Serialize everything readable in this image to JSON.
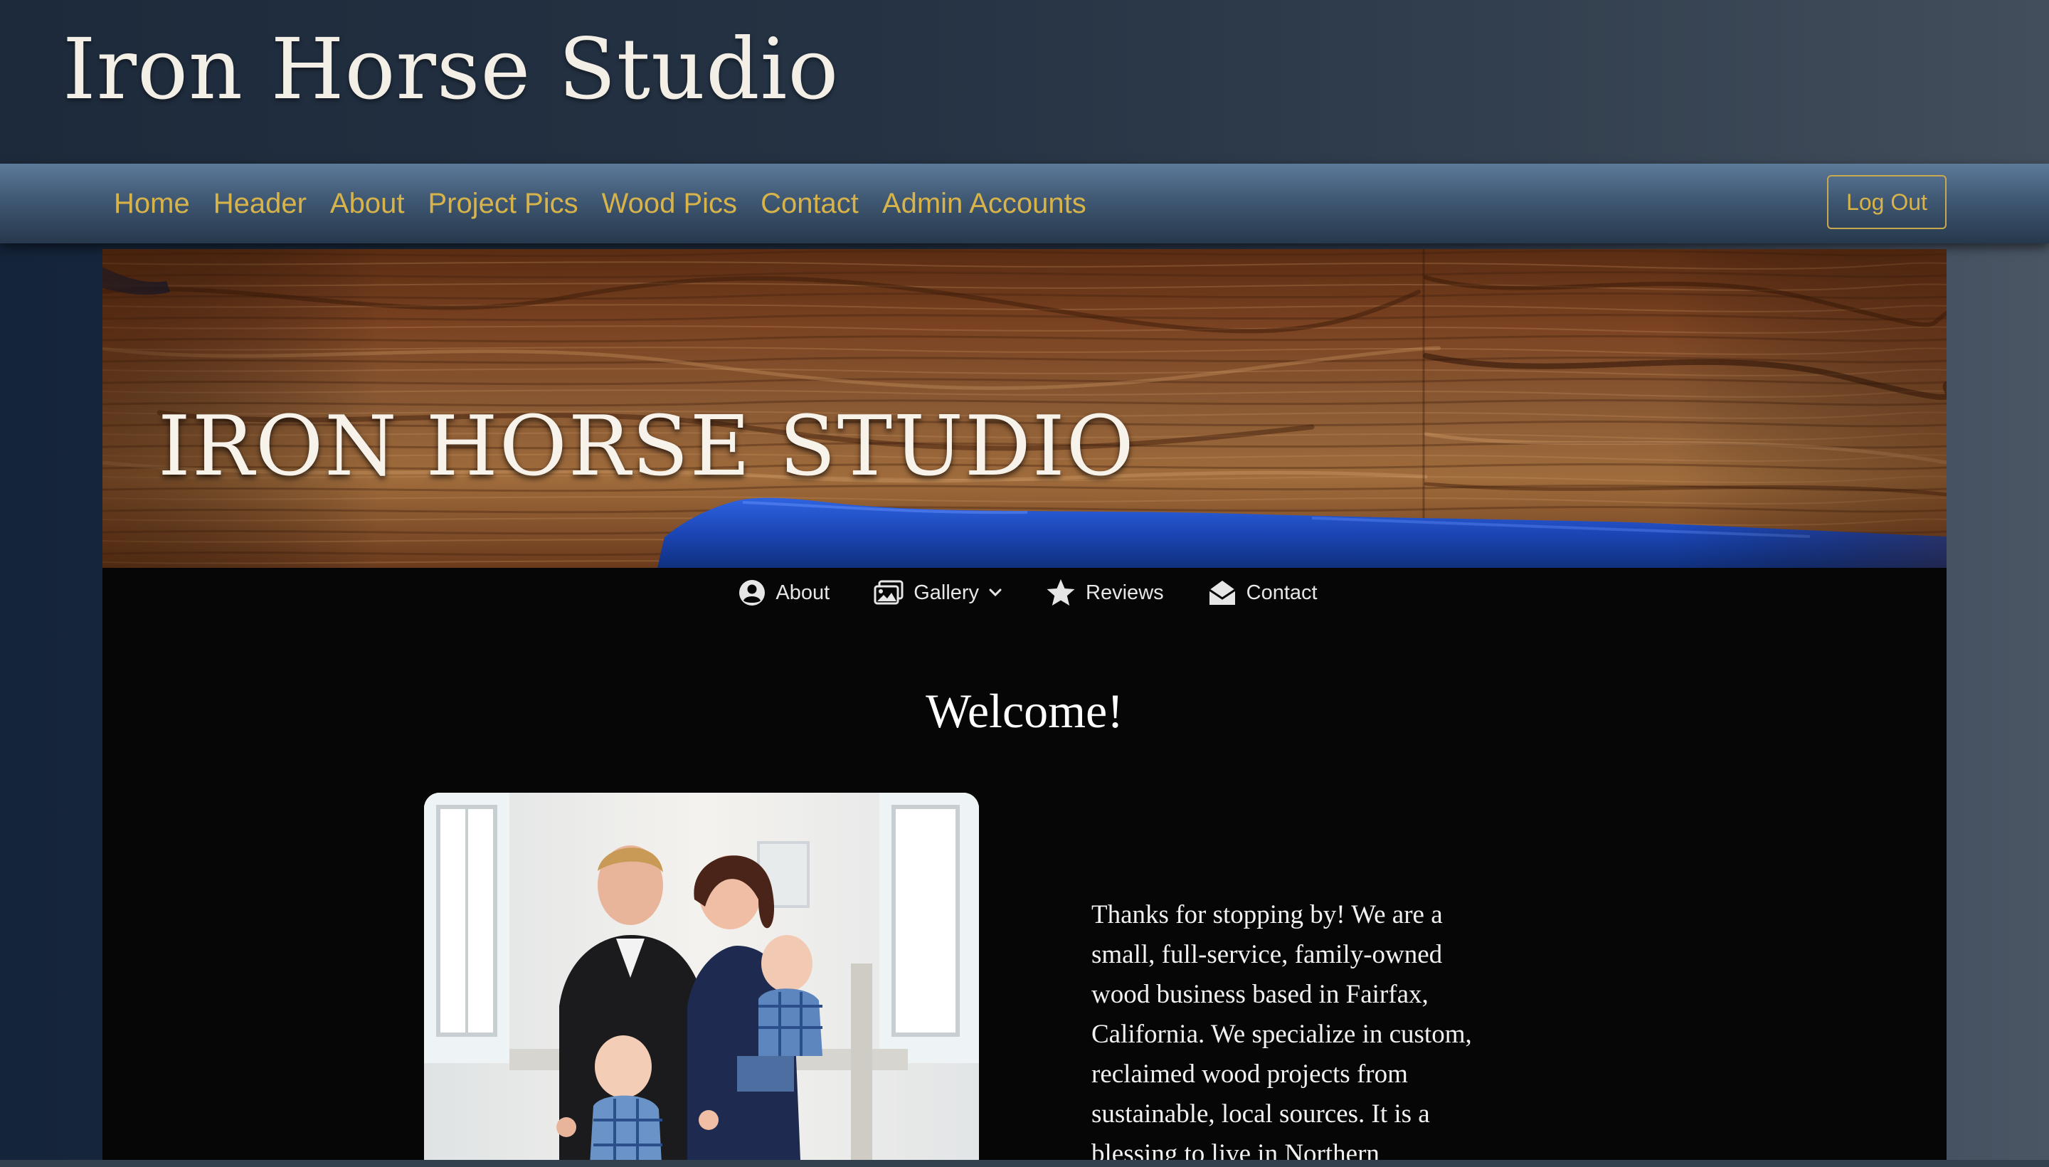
{
  "site": {
    "title": "Iron Horse Studio"
  },
  "admin_nav": {
    "links": [
      {
        "label": "Home"
      },
      {
        "label": "Header"
      },
      {
        "label": "About"
      },
      {
        "label": "Project Pics"
      },
      {
        "label": "Wood Pics"
      },
      {
        "label": "Contact"
      },
      {
        "label": "Admin Accounts"
      }
    ],
    "logout_label": "Log Out"
  },
  "hero": {
    "title": "IRON HORSE STUDIO"
  },
  "site_nav": {
    "items": [
      {
        "label": "About",
        "icon": "user-circle-icon"
      },
      {
        "label": "Gallery",
        "icon": "images-icon"
      },
      {
        "label": "Reviews",
        "icon": "star-icon"
      },
      {
        "label": "Contact",
        "icon": "envelope-open-icon"
      }
    ]
  },
  "main": {
    "heading": "Welcome!",
    "intro": "Thanks for stopping by! We are a small, full-service, family-owned wood business based in Fairfax, California. We specialize in custom, reclaimed wood projects from sustainable, local sources. It is a blessing to live in Northern"
  },
  "colors": {
    "link_gold": "#d7b34a",
    "panel_black": "#060606",
    "resin_blue": "#1d4fc4"
  }
}
